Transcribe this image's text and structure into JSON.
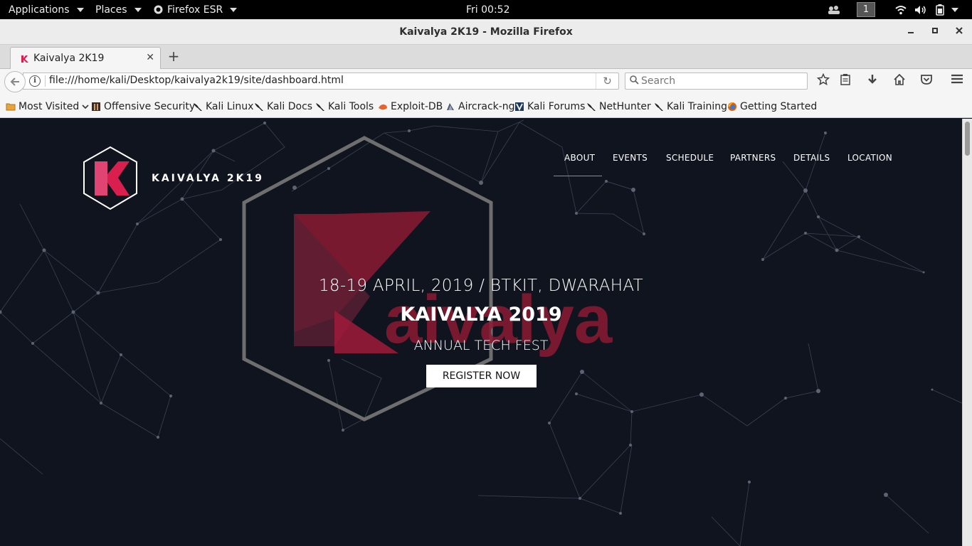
{
  "topbar": {
    "applications": "Applications",
    "places": "Places",
    "firefox": "Firefox ESR",
    "clock": "Fri 00:52",
    "workspace": "1",
    "icons": [
      "people-icon",
      "wifi-icon",
      "volume-icon",
      "battery-icon",
      "caret-icon"
    ]
  },
  "window": {
    "title": "Kaivalya 2K19 - Mozilla Firefox"
  },
  "tabs": [
    {
      "label": "Kaivalya 2K19"
    }
  ],
  "navbar": {
    "url": "file:///home/kali/Desktop/kaivalya2k19/site/dashboard.html",
    "search_placeholder": "Search"
  },
  "bookmarks": [
    {
      "label": "Most Visited",
      "icon": "folder-icon"
    },
    {
      "label": "Offensive Security",
      "icon": "offsec-icon"
    },
    {
      "label": "Kali Linux",
      "icon": "kali-dragon-icon"
    },
    {
      "label": "Kali Docs",
      "icon": "kali-dragon-icon"
    },
    {
      "label": "Kali Tools",
      "icon": "kali-dragon-icon"
    },
    {
      "label": "Exploit-DB",
      "icon": "exploitdb-icon"
    },
    {
      "label": "Aircrack-ng",
      "icon": "aircrack-icon"
    },
    {
      "label": "Kali Forums",
      "icon": "kali-forums-icon"
    },
    {
      "label": "NetHunter",
      "icon": "kali-dragon-icon"
    },
    {
      "label": "Kali Training",
      "icon": "kali-dragon-icon"
    },
    {
      "label": "Getting Started",
      "icon": "firefox-icon"
    }
  ],
  "site": {
    "brand": "KAIVALYA 2K19",
    "menu": [
      "ABOUT",
      "EVENTS",
      "SCHEDULE",
      "PARTNERS",
      "DETAILS",
      "LOCATION"
    ],
    "hero": {
      "date": "18-19 APRIL, 2019 / BTKIT, DWARAHAT",
      "title": "KAIVALYA 2019",
      "subtitle": "ANNUAL TECH FEST",
      "cta": "REGISTER NOW",
      "watermark": "aivalya"
    }
  },
  "colors": {
    "brand": "#d81f4e",
    "page_bg": "#10141f"
  }
}
